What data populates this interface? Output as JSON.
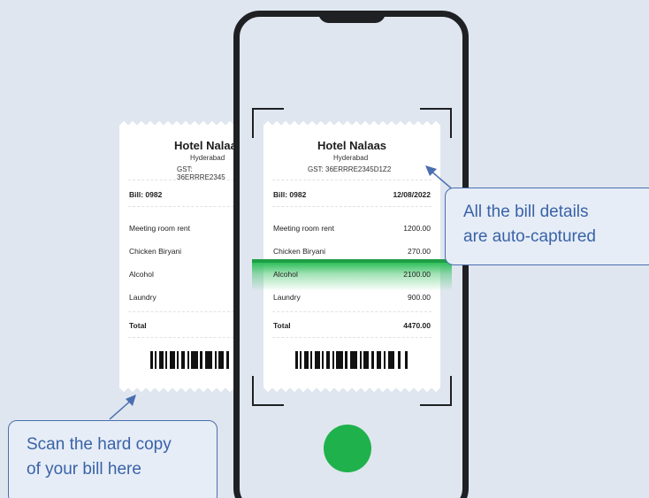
{
  "receipt_back": {
    "hotel": "Hotel Nalaa",
    "city": "Hyderabad",
    "gst": "GST: 36ERRRE2345",
    "bill": "Bill: 0982",
    "items": [
      "Meeting room rent",
      "Chicken Biryani",
      "Alcohol",
      "Laundry"
    ],
    "total_label": "Total"
  },
  "receipt_front": {
    "hotel": "Hotel Nalaas",
    "city": "Hyderabad",
    "gst": "GST: 36ERRRE2345D1Z2",
    "bill": "Bill: 0982",
    "date": "12/08/2022",
    "items": [
      {
        "name": "Meeting room rent",
        "amount": "1200.00"
      },
      {
        "name": "Chicken Biryani",
        "amount": "270.00"
      },
      {
        "name": "Alcohol",
        "amount": "2100.00"
      },
      {
        "name": "Laundry",
        "amount": "900.00"
      }
    ],
    "total_label": "Total",
    "total_amount": "4470.00"
  },
  "callouts": {
    "captured_line1": "All the bill details",
    "captured_line2": "are auto-captured",
    "scan_line1": "Scan the hard copy",
    "scan_line2": "of your bill here"
  },
  "colors": {
    "background": "#dfe6ef",
    "callout_border": "#4a6fb0",
    "callout_text": "#3a62a8",
    "scan_green": "#1f9d45",
    "shutter_green": "#1fb14b",
    "phone_frame": "#1f2023"
  },
  "icons": {
    "shutter": "camera-shutter-button"
  }
}
